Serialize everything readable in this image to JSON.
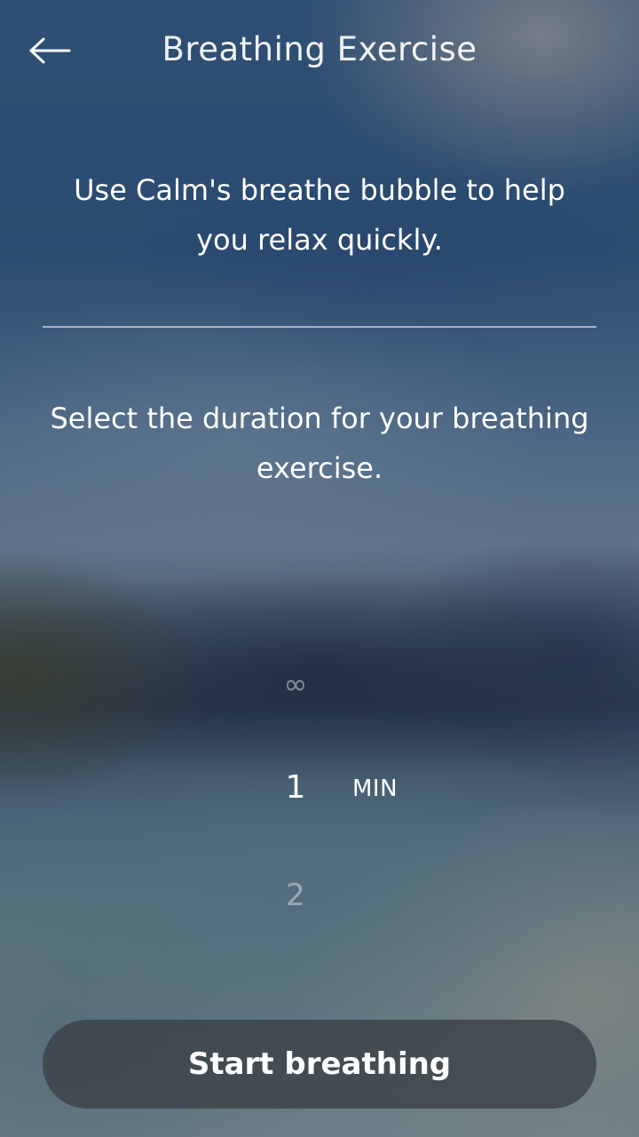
{
  "header": {
    "back_icon": "arrow-left-icon",
    "title": "Breathing Exercise"
  },
  "intro": {
    "text": "Use Calm's breathe bubble to help you relax quickly."
  },
  "duration": {
    "prompt": "Select the duration for your breathing exercise.",
    "options": [
      "∞",
      "1",
      "2"
    ],
    "selected": "1",
    "unit": "MIN"
  },
  "start_button": {
    "label": "Start breathing"
  },
  "colors": {
    "button_bg": "#3c4248",
    "text": "#ffffff",
    "muted_option": "#d2dae4"
  }
}
